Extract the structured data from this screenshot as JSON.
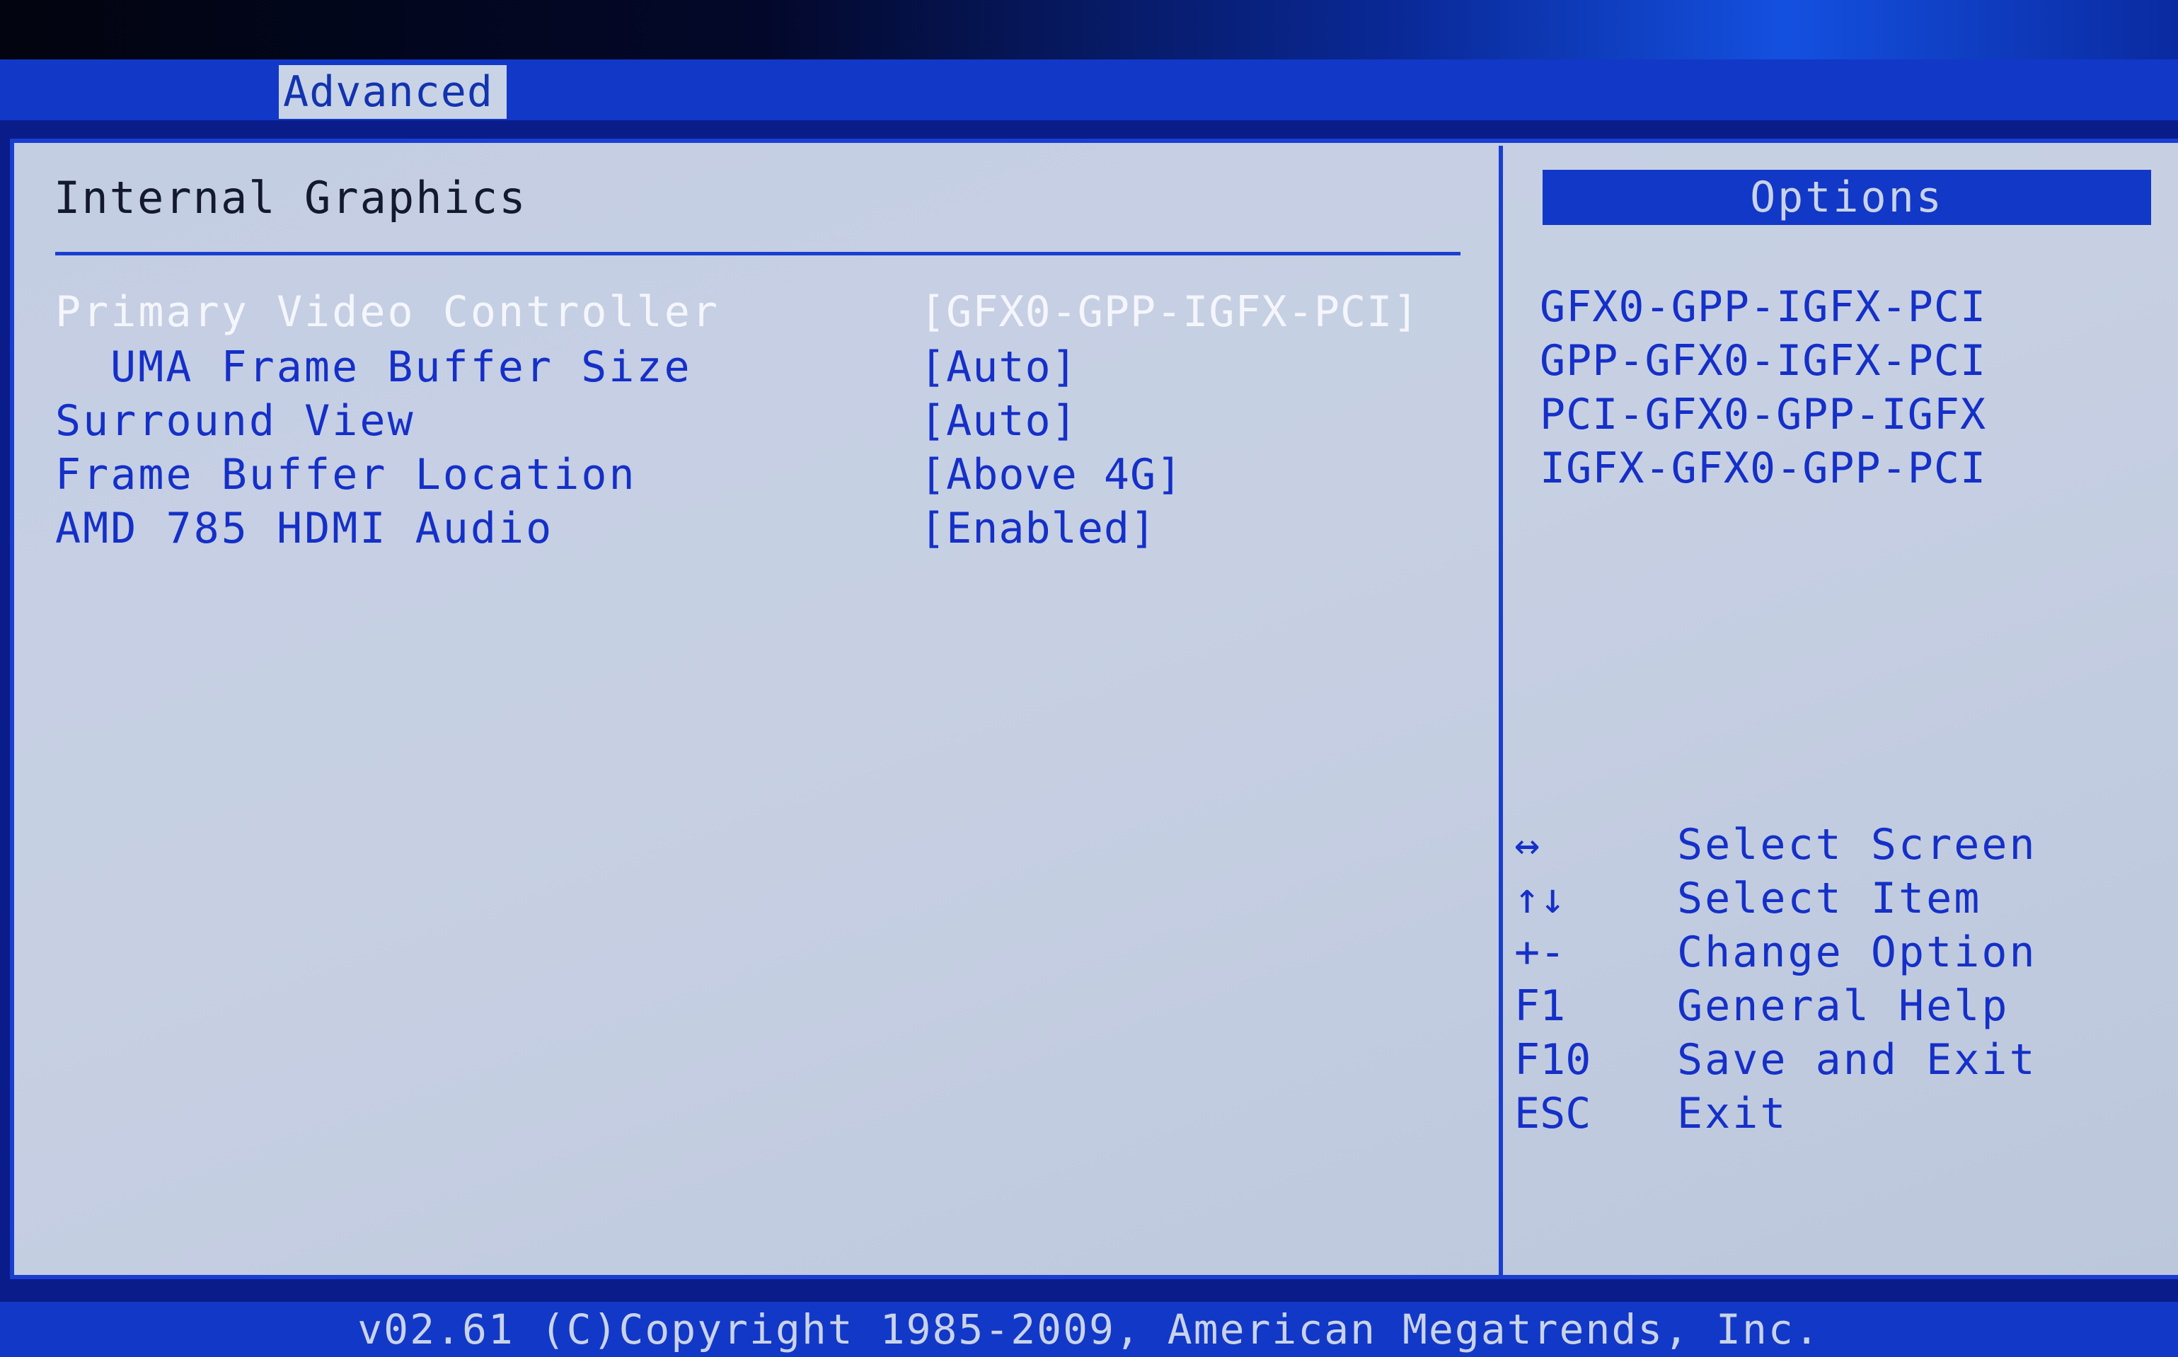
{
  "menu": {
    "active_tab": "Advanced"
  },
  "section": {
    "title": "Internal Graphics"
  },
  "settings": [
    {
      "label": "Primary Video Controller",
      "value": "[GFX0-GPP-IGFX-PCI]",
      "selected": true,
      "indent": false
    },
    {
      "label": "UMA Frame Buffer Size",
      "value": "[Auto]",
      "selected": false,
      "indent": true
    },
    {
      "label": "Surround View",
      "value": "[Auto]",
      "selected": false,
      "indent": false
    },
    {
      "label": "Frame Buffer Location",
      "value": "[Above 4G]",
      "selected": false,
      "indent": false
    },
    {
      "label": "AMD 785 HDMI Audio",
      "value": "[Enabled]",
      "selected": false,
      "indent": false
    }
  ],
  "options_panel": {
    "header": "Options",
    "items": [
      "GFX0-GPP-IGFX-PCI",
      "GPP-GFX0-IGFX-PCI",
      "PCI-GFX0-GPP-IGFX",
      "IGFX-GFX0-GPP-PCI"
    ]
  },
  "help": [
    {
      "key": "↔",
      "desc": "Select Screen"
    },
    {
      "key": "↑↓",
      "desc": "Select Item"
    },
    {
      "key": "+-",
      "desc": "Change Option"
    },
    {
      "key": "F1",
      "desc": "General Help"
    },
    {
      "key": "F10",
      "desc": "Save and Exit"
    },
    {
      "key": "ESC",
      "desc": "Exit"
    }
  ],
  "footer": {
    "copyright": "v02.61 (C)Copyright 1985-2009, American Megatrends, Inc."
  },
  "colors": {
    "frame_blue": "#1238c8",
    "panel_gray": "#c4cee3",
    "item_text": "#1530c8",
    "selected_text": "#f4f6fb"
  }
}
